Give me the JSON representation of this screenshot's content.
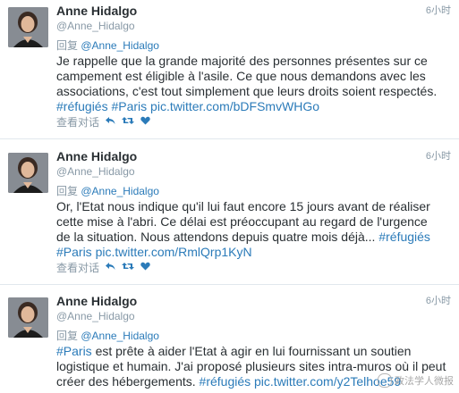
{
  "tweets": [
    {
      "name": "Anne Hidalgo",
      "handle": "@Anne_Hidalgo",
      "time": "6小时",
      "reply_prefix": "回复",
      "reply_to": "@Anne_Hidalgo",
      "lines": [
        [
          {
            "t": "Je rappelle que la grande majorité des personnes présentes sur ce",
            "l": false
          }
        ],
        [
          {
            "t": "campement est éligible à l'asile. Ce que nous demandons avec les",
            "l": false
          }
        ],
        [
          {
            "t": "associations, c'est tout simplement que leurs droits soient respectés.",
            "l": false
          }
        ],
        [
          {
            "t": "#réfugiés #Paris pic.twitter.com/bDFSmvWHGo",
            "l": true
          }
        ]
      ],
      "actions": {
        "view": "查看对话",
        "reply_icon": "reply-icon",
        "retweet_icon": "retweet-icon",
        "like_icon": "heart-icon"
      }
    },
    {
      "name": "Anne Hidalgo",
      "handle": "@Anne_Hidalgo",
      "time": "6小时",
      "reply_prefix": "回复",
      "reply_to": "@Anne_Hidalgo",
      "lines": [
        [
          {
            "t": "Or, l'Etat nous indique qu'il lui faut encore 15 jours avant de réaliser",
            "l": false
          }
        ],
        [
          {
            "t": "cette mise à l'abri. Ce délai est préoccupant au regard de l'urgence",
            "l": false
          }
        ],
        [
          {
            "t": "de la situation. Nous attendons depuis quatre mois déjà... ",
            "l": false
          },
          {
            "t": "#réfugiés",
            "l": true
          }
        ],
        [
          {
            "t": "#Paris pic.twitter.com/RmlQrp1KyN",
            "l": true
          }
        ]
      ],
      "actions": {
        "view": "查看对话",
        "reply_icon": "reply-icon",
        "retweet_icon": "retweet-icon",
        "like_icon": "heart-icon"
      }
    },
    {
      "name": "Anne Hidalgo",
      "handle": "@Anne_Hidalgo",
      "time": "6小时",
      "reply_prefix": "回复",
      "reply_to": "@Anne_Hidalgo",
      "lines": [
        [
          {
            "t": "#Paris",
            "l": true
          },
          {
            "t": " est prête à aider l'Etat à agir en lui fournissant un soutien",
            "l": false
          }
        ],
        [
          {
            "t": "logistique et humain. J'ai proposé plusieurs sites intra-muros où il peut",
            "l": false
          }
        ],
        [
          {
            "t": "créer des hébergements. ",
            "l": false
          },
          {
            "t": "#réfugiés pic.twitter.com/y2Telhoe59",
            "l": true
          }
        ]
      ],
      "actions": null
    }
  ],
  "watermark": "政法学人微报"
}
